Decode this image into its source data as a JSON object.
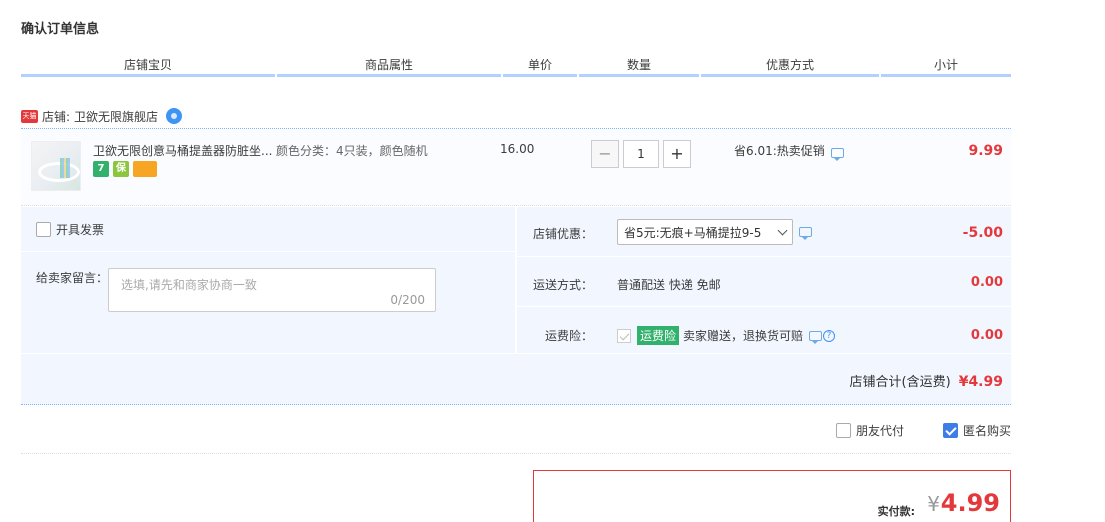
{
  "section_title": "确认订单信息",
  "columns": [
    "店铺宝贝",
    "商品属性",
    "单价",
    "数量",
    "优惠方式",
    "小计"
  ],
  "shop": {
    "badge": "天猫",
    "label": "店铺:",
    "name": "卫欲无限旗舰店"
  },
  "item": {
    "title": "卫欲无限创意马桶提盖器防脏坐便器",
    "title_display": "卫欲无限创意马桶提盖器防脏坐...",
    "badges": [
      "7",
      "保",
      ""
    ],
    "attr": "颜色分类：4只装，颜色随机",
    "price": "16.00",
    "qty_minus": "−",
    "qty": "1",
    "qty_plus": "+",
    "promo": "省6.01:热卖促销",
    "subtotal": "9.99"
  },
  "options": {
    "invoice_label": "开具发票",
    "message_label": "给卖家留言：",
    "message_placeholder": "选填,请先和商家协商一致",
    "message_count": "0/200",
    "shop_discount_label": "店铺优惠：",
    "shop_discount_value": "省5元:无痕+马桶提拉9-5",
    "shop_discount_amount": "-5.00",
    "shipping_label": "运送方式：",
    "shipping_value": "普通配送 快递 免邮",
    "shipping_amount": "0.00",
    "insurance_label": "运费险：",
    "insurance_badge": "运费险",
    "insurance_value": "卖家赠送，退换货可赔",
    "insurance_amount": "0.00"
  },
  "shop_total": {
    "label": "店铺合计(含运费)",
    "amount": "¥4.99"
  },
  "extra": {
    "friend_pay": "朋友代付",
    "anonymous": "匿名购买"
  },
  "payment": {
    "label": "实付款:",
    "currency": "¥",
    "amount": "4.99"
  },
  "colors": {
    "accent_red": "#e4393c",
    "header_blue": "#b2d1ff",
    "panel_bg": "#f2f7ff",
    "insurance_green": "#31b16c"
  }
}
